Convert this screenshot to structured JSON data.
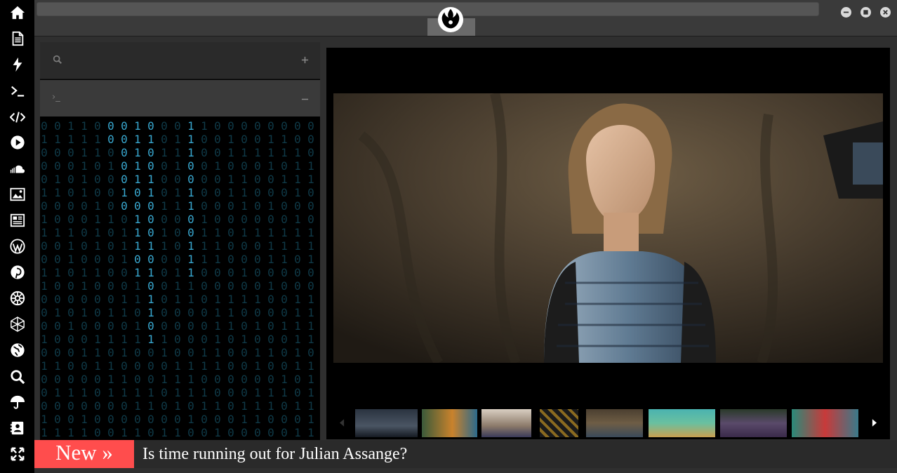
{
  "sidebar": {
    "items": [
      {
        "icon": "home-icon"
      },
      {
        "icon": "document-icon"
      },
      {
        "icon": "bolt-icon"
      },
      {
        "icon": "terminal-icon"
      },
      {
        "icon": "code-icon"
      },
      {
        "icon": "play-icon"
      },
      {
        "icon": "soundcloud-icon"
      },
      {
        "icon": "image-icon"
      },
      {
        "icon": "newspaper-icon"
      },
      {
        "icon": "wordpress-icon"
      },
      {
        "icon": "pinterest-icon"
      },
      {
        "icon": "galactic-empire-icon"
      },
      {
        "icon": "hexagon-network-icon"
      },
      {
        "icon": "globe-icon"
      },
      {
        "icon": "search-icon"
      },
      {
        "icon": "umbrella-icon"
      },
      {
        "icon": "contact-card-icon"
      },
      {
        "icon": "fullscreen-icon"
      }
    ]
  },
  "topbar": {
    "logo": "rebel-alliance-icon",
    "window_buttons": [
      "minimize-icon",
      "maximize-icon",
      "close-icon"
    ]
  },
  "left_panel": {
    "search_icon": "search-icon",
    "add_icon": "plus-icon",
    "console_prompt": "›_",
    "collapse_icon": "minus-icon",
    "matrix_digits": [
      "0",
      "1"
    ]
  },
  "viewer": {
    "main_image": "portrait-photo",
    "thumbnails": [
      "superhero-group-thumb",
      "cartoon-duck-thumb",
      "woman-hat-thumb",
      "hazard-stripes-thumb",
      "portrait-thumb",
      "landscape-thumb",
      "jungle-woman-thumb",
      "red-hair-fantasy-thumb"
    ],
    "prev_icon": "caret-left-icon",
    "next_icon": "caret-right-icon"
  },
  "ticker": {
    "badge": "New »",
    "headline": "Is time running out for Julian Assange?"
  },
  "colors": {
    "accent": "#ff4d4d",
    "matrix_bright": "#38a7cf",
    "matrix_dim": "#0f3a48"
  }
}
